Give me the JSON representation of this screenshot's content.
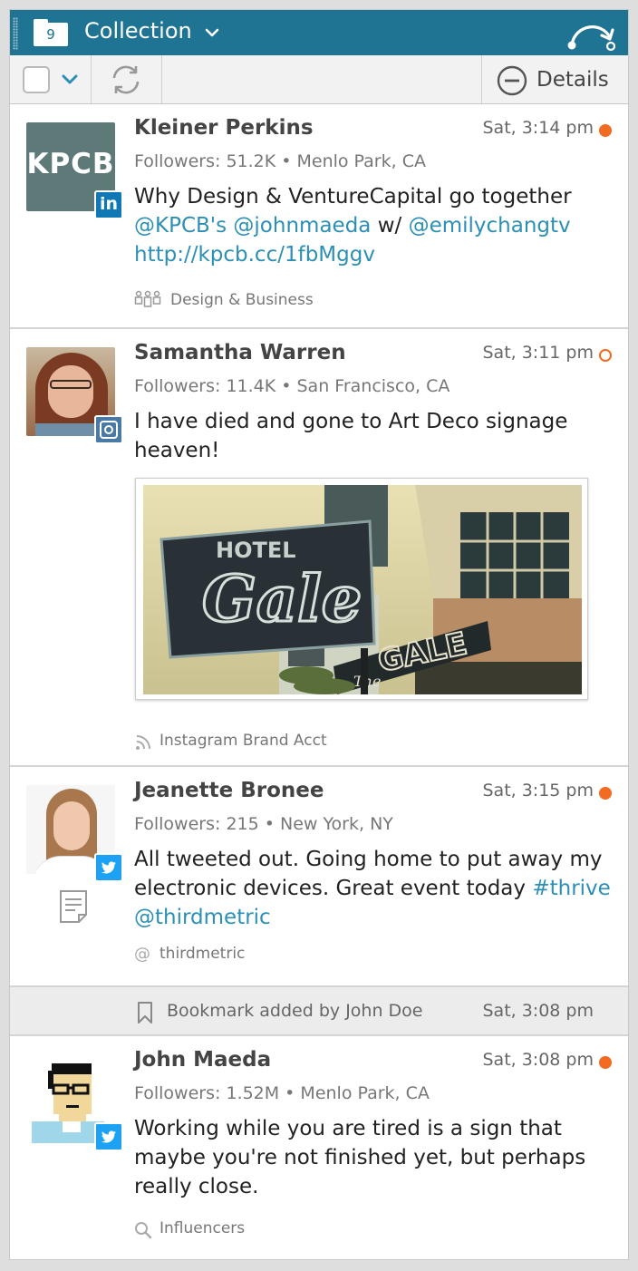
{
  "header": {
    "collection_count": "9",
    "title": "Collection"
  },
  "toolbar": {
    "details_label": "Details"
  },
  "colors": {
    "header_bg": "#1f7393",
    "link": "#2c8fb6",
    "unread_dot": "#f26b21"
  },
  "posts": [
    {
      "name": "Kleiner Perkins",
      "time": "Sat, 3:14 pm",
      "status": "unread",
      "meta": "Followers: 51.2K • Menlo Park, CA",
      "avatar_text": "KPCB",
      "network": "linkedin",
      "text": {
        "p1": "Why Design & VentureCapital go together",
        "l1": "@KPCB's",
        "l2": "@johnmaeda",
        "p2": "w/",
        "l3": "@emilychangtv",
        "l4": "http://kpcb.cc/1fbMggv"
      },
      "tag": "Design & Business"
    },
    {
      "name": "Samantha Warren",
      "time": "Sat, 3:11 pm",
      "status": "read",
      "meta": "Followers: 11.4K • San Francisco, CA",
      "network": "instagram",
      "text": {
        "p1": "I have died and gone to Art Deco signage heaven!"
      },
      "image_text": {
        "hotel": "HOTEL",
        "gale": "Gale",
        "the": "The",
        "gale2": "GALE"
      },
      "tag": "Instagram Brand Acct"
    },
    {
      "name": "Jeanette Bronee",
      "time": "Sat, 3:15 pm",
      "status": "unread",
      "meta": "Followers: 215 • New York, NY",
      "network": "twitter",
      "text": {
        "p1": "All tweeted out. Going home to put away my electronic devices. Great event today",
        "l1": "#thrive",
        "l2": "@thirdmetric"
      },
      "tag": "thirdmetric"
    },
    {
      "name": "John Maeda",
      "time": "Sat, 3:08 pm",
      "status": "unread",
      "meta": "Followers: 1.52M • Menlo Park, CA",
      "network": "twitter",
      "text": {
        "p1": "Working while you are tired is a sign that maybe you're not finished yet, but perhaps really close."
      },
      "tag": "Influencers"
    }
  ],
  "bookmark": {
    "text": "Bookmark added by John Doe",
    "time": "Sat, 3:08 pm"
  }
}
